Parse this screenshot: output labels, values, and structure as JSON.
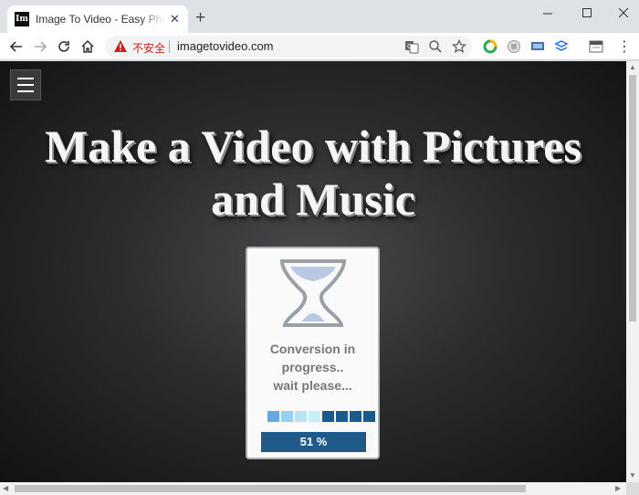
{
  "browser": {
    "tab": {
      "favicon_text": "Im",
      "title": "Image To Video - Easy Photo to Video Maker",
      "close_glyph": "✕"
    },
    "new_tab_glyph": "+",
    "window_controls": {
      "minimize": "—",
      "maximize": "☐",
      "close": "✕"
    },
    "address_bar": {
      "security_text": "不安全",
      "url": "imagetovideo.com"
    },
    "icons": [
      "back-icon",
      "forward-icon",
      "reload-icon",
      "home-icon",
      "warning-icon",
      "translate-icon",
      "zoom-icon",
      "bookmark-star-icon"
    ],
    "menu_glyph": "⋮"
  },
  "page": {
    "headline_line1": "Make a Video with Pictures",
    "headline_line2": "and Music",
    "card": {
      "status_line1": "Conversion in",
      "status_line2": "progress..",
      "status_line3": "wait please...",
      "progress_text": "51 %",
      "progress_fraction": 0.51,
      "segment_colors": [
        "#64a8e0",
        "#94d0f0",
        "#b8e4f5",
        "#c8eef8",
        "#1b5a8c",
        "#1b5a8c",
        "#1b5a8c",
        "#1b5a8c"
      ]
    }
  },
  "colors": {
    "progress_bar": "#1f5a8a",
    "insecure": "#c5221f"
  }
}
